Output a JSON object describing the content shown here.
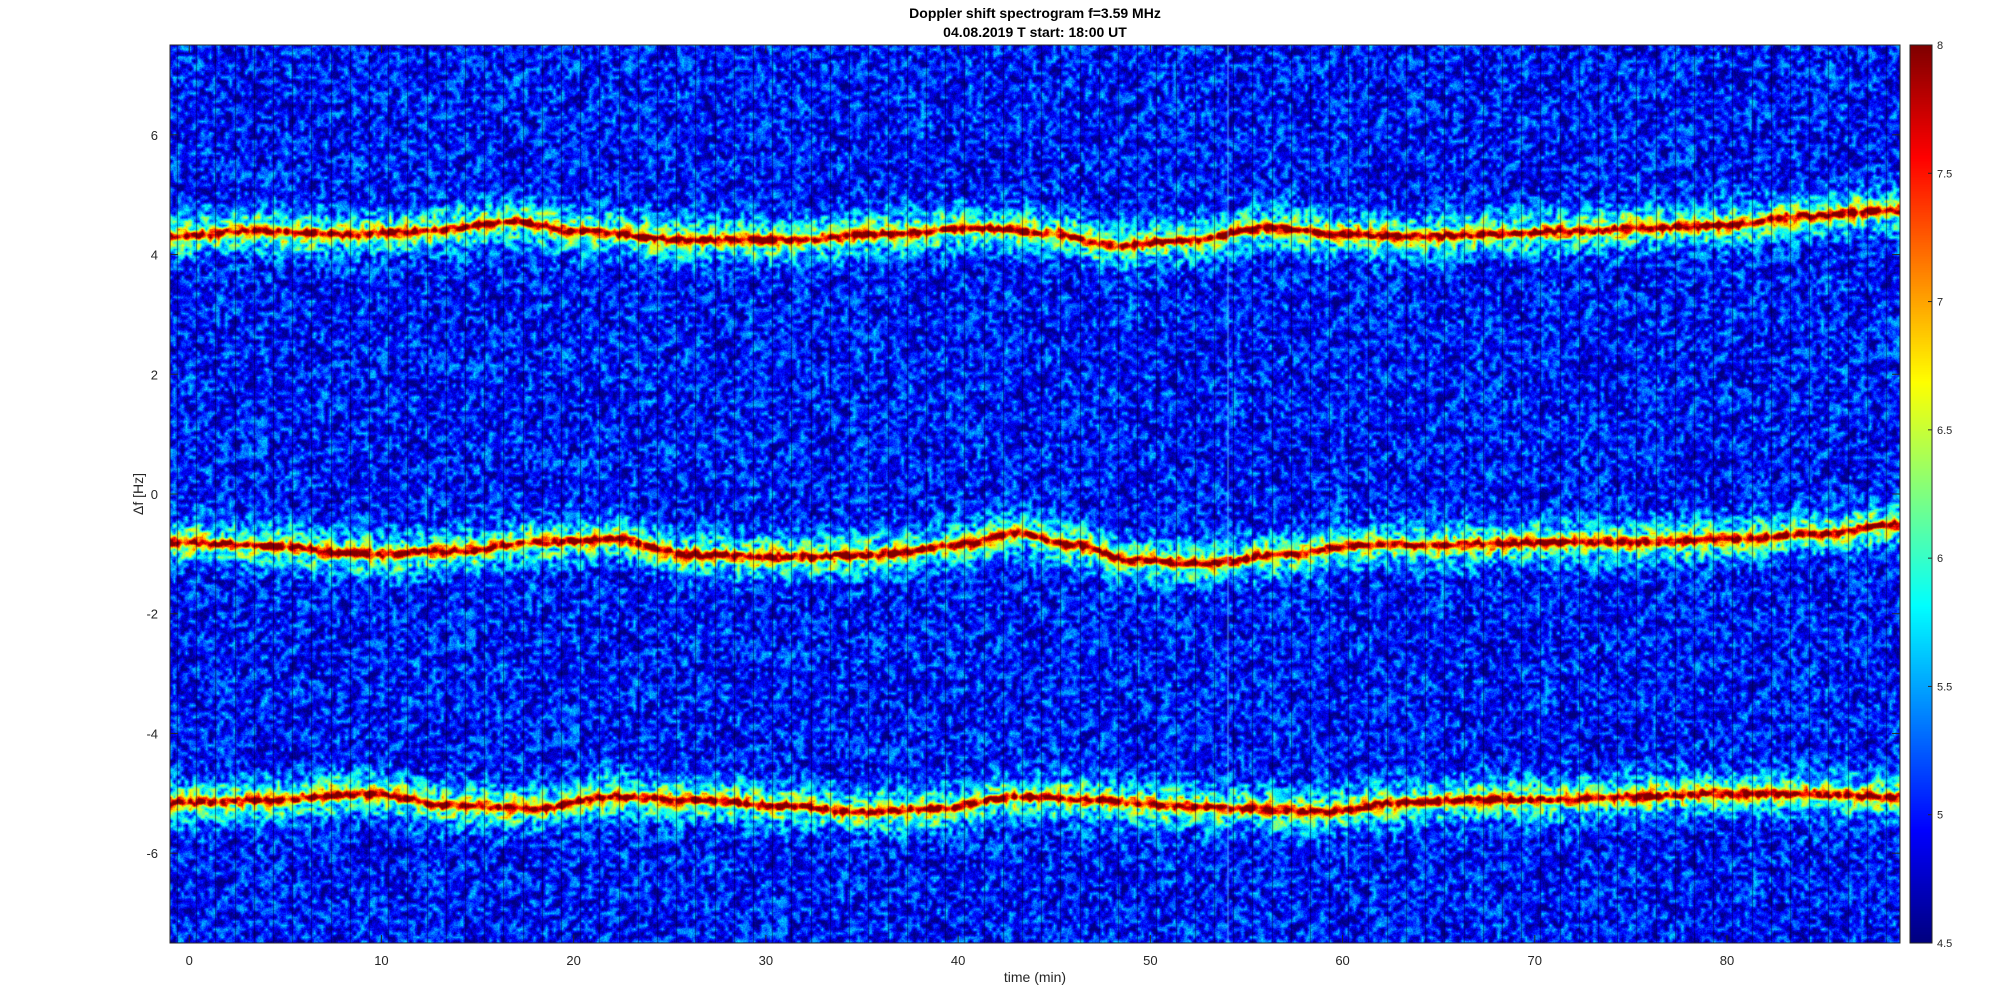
{
  "chart_data": {
    "type": "heatmap",
    "title": "Doppler shift spectrogram f=3.59 MHz",
    "subtitle": "04.08.2019    T start: 18:00 UT",
    "xlabel": "time (min)",
    "ylabel": "Δf [Hz]",
    "xlim": [
      -1,
      89
    ],
    "ylim": [
      -7.5,
      7.5
    ],
    "x_ticks": [
      0,
      10,
      20,
      30,
      40,
      50,
      60,
      70,
      80
    ],
    "y_ticks": [
      -6,
      -4,
      -2,
      0,
      2,
      4,
      6
    ],
    "colormap": "jet",
    "clim": [
      4.5,
      8
    ],
    "colorbar_ticks": [
      4.5,
      5,
      5.5,
      6,
      6.5,
      7,
      7.5,
      8
    ],
    "background_level": 5.0,
    "traces": [
      {
        "x": [
          -1,
          3,
          8,
          12,
          17,
          20,
          26,
          31,
          36,
          41,
          45,
          48,
          52,
          56,
          60,
          64,
          68,
          72,
          76,
          80,
          84,
          89
        ],
        "y": [
          4.3,
          4.4,
          4.35,
          4.4,
          4.55,
          4.4,
          4.25,
          4.25,
          4.35,
          4.45,
          4.35,
          4.15,
          4.25,
          4.45,
          4.35,
          4.3,
          4.35,
          4.4,
          4.45,
          4.5,
          4.65,
          4.75
        ]
      },
      {
        "x": [
          -1,
          4,
          9,
          14,
          18,
          22,
          26,
          31,
          36,
          40,
          43,
          46,
          49,
          53,
          57,
          61,
          65,
          70,
          75,
          80,
          85,
          89
        ],
        "y": [
          -0.8,
          -0.85,
          -1.0,
          -0.95,
          -0.8,
          -0.75,
          -1.0,
          -1.05,
          -1.0,
          -0.85,
          -0.65,
          -0.85,
          -1.1,
          -1.15,
          -1.0,
          -0.85,
          -0.85,
          -0.8,
          -0.8,
          -0.75,
          -0.65,
          -0.5
        ]
      },
      {
        "x": [
          -1,
          4,
          9,
          14,
          18,
          22,
          26,
          31,
          35,
          39,
          43,
          47,
          51,
          55,
          59,
          63,
          67,
          71,
          75,
          79,
          84,
          89
        ],
        "y": [
          -5.15,
          -5.1,
          -5.0,
          -5.2,
          -5.25,
          -5.05,
          -5.1,
          -5.2,
          -5.3,
          -5.25,
          -5.05,
          -5.1,
          -5.2,
          -5.25,
          -5.3,
          -5.15,
          -5.1,
          -5.1,
          -5.05,
          -5.0,
          -5.0,
          -5.05
        ]
      }
    ]
  }
}
